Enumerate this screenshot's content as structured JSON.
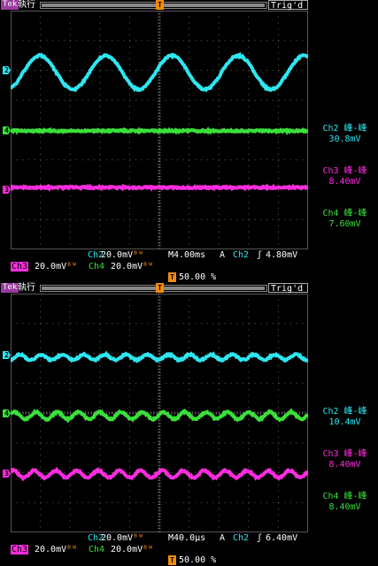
{
  "colors": {
    "ch2": "#2ee6f0",
    "ch3": "#ff2ce0",
    "ch4": "#3ae03a",
    "tek": "#9a3aa0",
    "trigger": "#f28b0a"
  },
  "screens": [
    {
      "header": {
        "brand": "Tek",
        "state": "執行",
        "trig_status": "Trig'd"
      },
      "markers": {
        "ch2": "2",
        "ch4": "4",
        "ch3": "3",
        "trigger_top": "T"
      },
      "measurements": [
        {
          "label": "Ch2 峰-峰",
          "value": "30.8mV"
        },
        {
          "label": "Ch3 峰-峰",
          "value": "8.40mV"
        },
        {
          "label": "Ch4 峰-峰",
          "value": "7.60mV"
        }
      ],
      "footer": {
        "ch2_label": "Ch2",
        "ch2_scale": "20.0mV",
        "ch3_label": "Ch3",
        "ch3_scale": "20.0mV",
        "ch4_label": "Ch4",
        "ch4_scale": "20.0mV",
        "bw_glyph": "ᴮᵂ",
        "timebase": "M4.00ms",
        "acq_mode": "A",
        "trig_source": "Ch2",
        "trig_slope": "ʃ",
        "trig_level": "4.80mV",
        "trig_pos": "50.00 %"
      },
      "waveforms": {
        "ch2_cycles": 4.5,
        "ch2_amp": 19,
        "ch4_cycles": 0,
        "ch3_cycles": 0
      }
    },
    {
      "header": {
        "brand": "Tek",
        "state": "執行",
        "trig_status": "Trig'd"
      },
      "markers": {
        "ch2": "2",
        "ch4": "4",
        "ch3": "3",
        "trigger_top": "T"
      },
      "measurements": [
        {
          "label": "Ch2 峰-峰",
          "value": "10.4mV"
        },
        {
          "label": "Ch3 峰-峰",
          "value": "8.40mV"
        },
        {
          "label": "Ch4 峰-峰",
          "value": "8.40mV"
        }
      ],
      "footer": {
        "ch2_label": "Ch2",
        "ch2_scale": "20.0mV",
        "ch3_label": "Ch3",
        "ch3_scale": "20.0mV",
        "ch4_label": "Ch4",
        "ch4_scale": "20.0mV",
        "bw_glyph": "ᴮᵂ",
        "timebase": "M40.0µs",
        "acq_mode": "A",
        "trig_source": "Ch2",
        "trig_slope": "ʃ",
        "trig_level": "6.40mV",
        "trig_pos": "50.00 %"
      },
      "waveforms": {
        "ch2_cycles": 14,
        "ch2_amp": 3,
        "ch4_cycles": 14,
        "ch3_cycles": 14
      }
    }
  ]
}
